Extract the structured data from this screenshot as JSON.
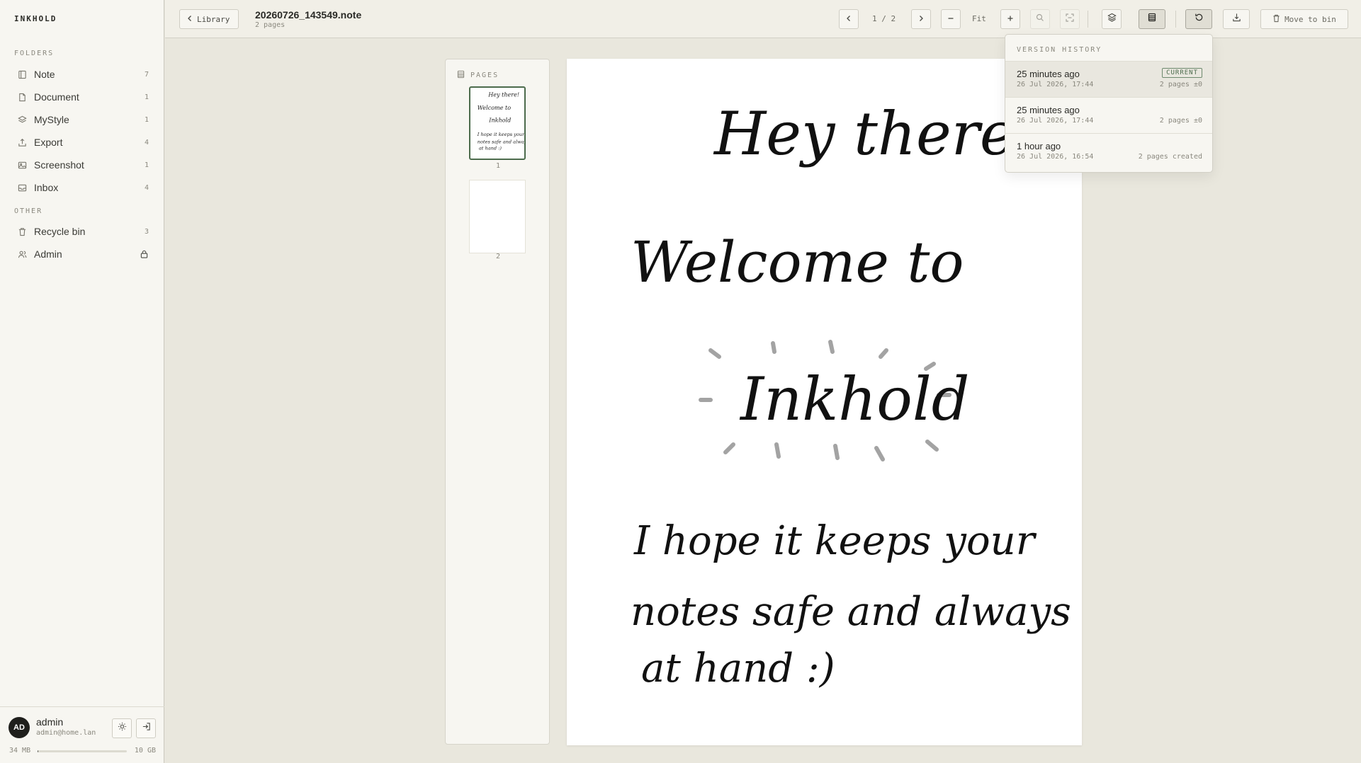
{
  "app": {
    "brand": "INKHOLD"
  },
  "sidebar": {
    "folders_label": "FOLDERS",
    "other_label": "OTHER",
    "folders": [
      {
        "label": "Note",
        "count": "7",
        "icon": "notebook-icon"
      },
      {
        "label": "Document",
        "count": "1",
        "icon": "document-icon"
      },
      {
        "label": "MyStyle",
        "count": "1",
        "icon": "layers-icon"
      },
      {
        "label": "Export",
        "count": "4",
        "icon": "export-icon"
      },
      {
        "label": "Screenshot",
        "count": "1",
        "icon": "image-icon"
      },
      {
        "label": "Inbox",
        "count": "4",
        "icon": "inbox-icon"
      }
    ],
    "other": [
      {
        "label": "Recycle bin",
        "count": "3",
        "icon": "trash-icon"
      },
      {
        "label": "Admin",
        "count": "",
        "icon": "users-icon"
      }
    ],
    "user": {
      "initials": "AD",
      "name": "admin",
      "email": "admin@home.lan",
      "storage_used": "34 MB",
      "storage_total": "10 GB",
      "storage_fraction": 0.0034
    }
  },
  "toolbar": {
    "library_label": "Library",
    "doc_title": "20260726_143549.note",
    "doc_subtitle": "2 pages",
    "page_indicator": "1 / 2",
    "zoom_label": "Fit",
    "move_to_bin_label": "Move to bin"
  },
  "pages_panel": {
    "title": "PAGES",
    "pages": [
      {
        "number": "1"
      },
      {
        "number": "2"
      }
    ]
  },
  "version_history": {
    "title": "VERSION HISTORY",
    "items": [
      {
        "ago": "25 minutes ago",
        "date": "26 Jul 2026, 17:44",
        "meta": "2 pages ±0",
        "badge": "CURRENT"
      },
      {
        "ago": "25 minutes ago",
        "date": "26 Jul 2026, 17:44",
        "meta": "2 pages ±0"
      },
      {
        "ago": "1 hour ago",
        "date": "26 Jul 2026, 16:54",
        "meta": "2 pages created"
      }
    ]
  },
  "note_content": {
    "lines": [
      "Hey there!",
      "Welcome to",
      "Inkhold",
      "I hope it keeps your",
      "notes safe and always",
      "at hand :)"
    ]
  }
}
